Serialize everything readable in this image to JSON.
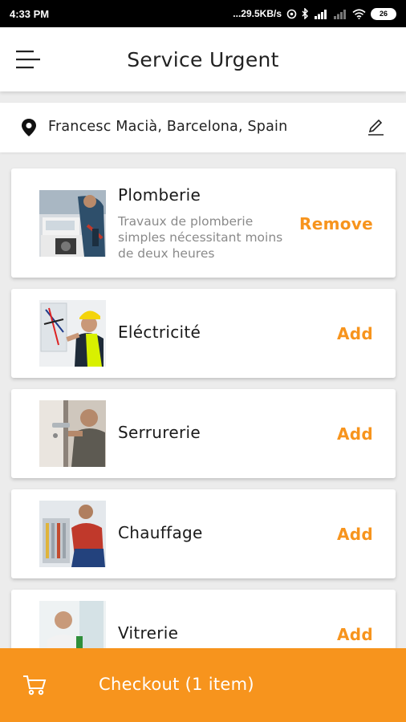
{
  "status_bar": {
    "time": "4:33 PM",
    "net_speed": "...29.5KB/s",
    "battery": "26"
  },
  "header": {
    "title": "Service Urgent",
    "menu_icon": "hamburger-menu-icon"
  },
  "location": {
    "address": "Francesc Macià, Barcelona, Spain",
    "pin_icon": "location-pin-icon",
    "edit_icon": "edit-pencil-icon"
  },
  "services": [
    {
      "name": "Plomberie",
      "description": "Travaux de plomberie simples nécessitant moins de deux heures",
      "action": "Remove",
      "image": "plumber-photo"
    },
    {
      "name": "Eléctricité",
      "description": "",
      "action": "Add",
      "image": "electrician-photo"
    },
    {
      "name": "Serrurerie",
      "description": "",
      "action": "Add",
      "image": "locksmith-photo"
    },
    {
      "name": "Chauffage",
      "description": "",
      "action": "Add",
      "image": "heating-technician-photo"
    },
    {
      "name": "Vitrerie",
      "description": "",
      "action": "Add",
      "image": "glazier-photo"
    }
  ],
  "checkout": {
    "label": "Checkout (1 item)",
    "cart_icon": "shopping-cart-icon"
  },
  "colors": {
    "accent": "#f7941d",
    "status_bar": "#000000",
    "text_primary": "#1a1a1a",
    "text_secondary": "#8a8a8a"
  }
}
